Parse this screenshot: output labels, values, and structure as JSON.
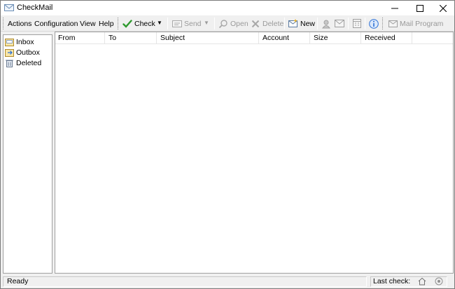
{
  "window": {
    "title": "CheckMail"
  },
  "menu": {
    "actions": "Actions",
    "configuration": "Configuration",
    "view": "View",
    "help": "Help"
  },
  "toolbar": {
    "check": "Check",
    "send": "Send",
    "open": "Open",
    "delete": "Delete",
    "new": "New",
    "mail_program": "Mail Program"
  },
  "folders": [
    "Inbox",
    "Outbox",
    "Deleted"
  ],
  "columns": [
    "From",
    "To",
    "Subject",
    "Account",
    "Size",
    "Received"
  ],
  "status": {
    "left": "Ready",
    "right": "Last check:"
  },
  "colors": {
    "check_green": "#2e9a2e",
    "info_blue": "#2a6fd6",
    "disabled_gray": "#9a9a9a"
  }
}
